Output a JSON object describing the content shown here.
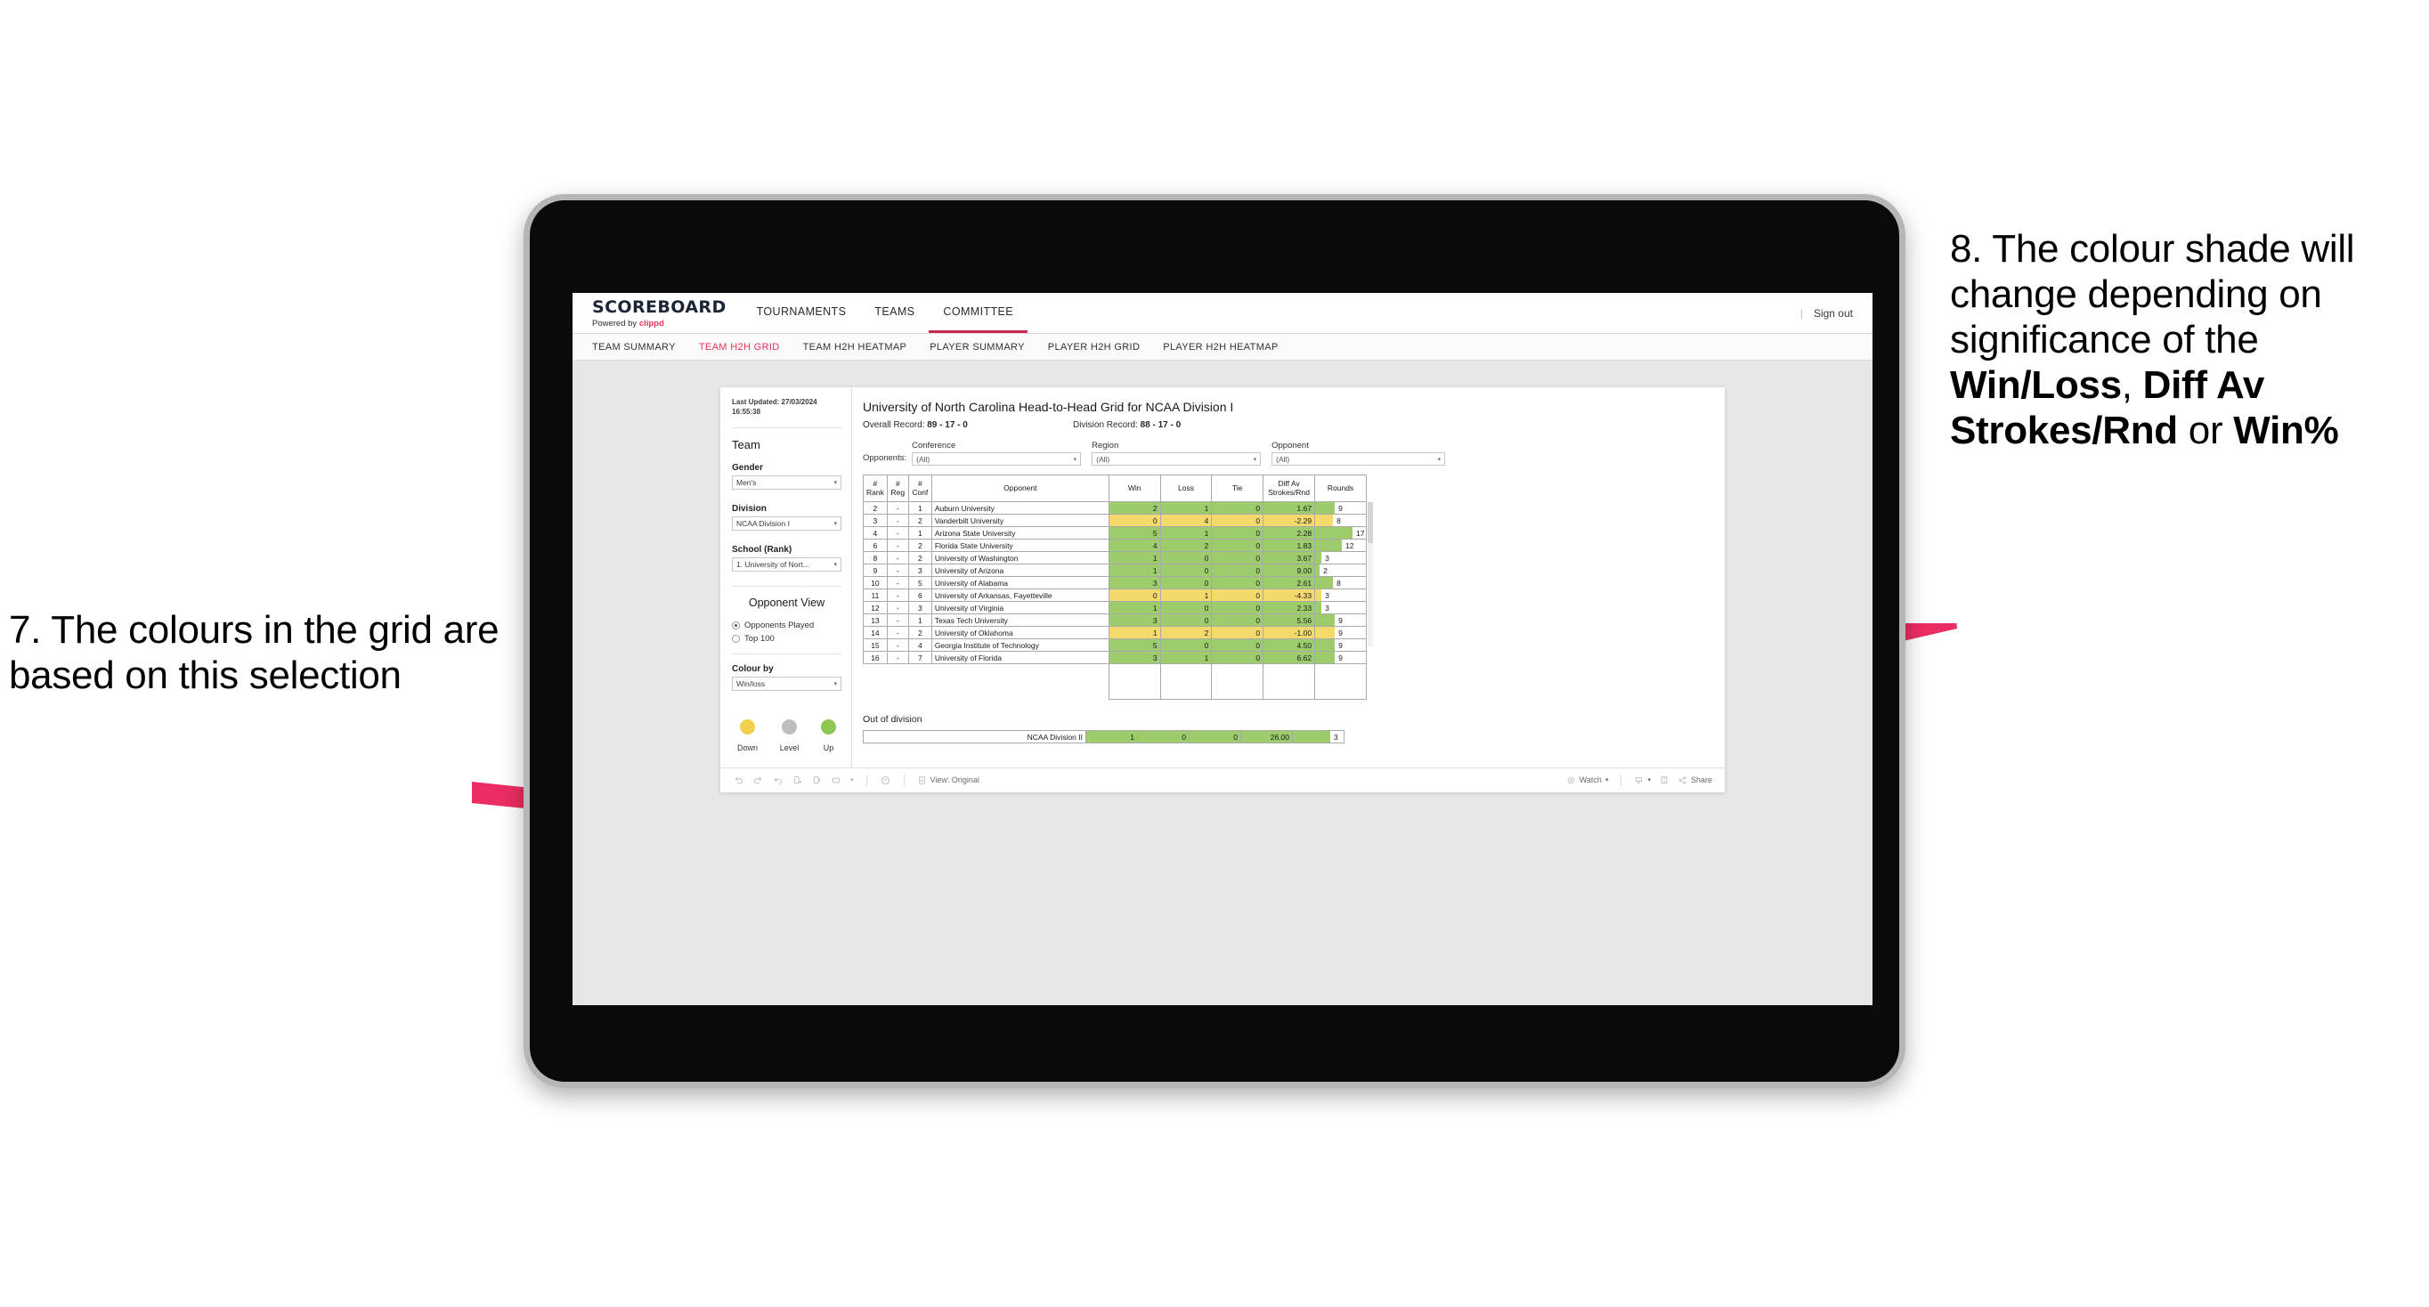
{
  "annotations": {
    "left": {
      "num": "7.",
      "text": "The colours in the grid are based on this selection"
    },
    "right": {
      "num": "8.",
      "lead": "The colour shade will change depending on significance of the ",
      "b1": "Win/Loss",
      "mid1": ", ",
      "b2": "Diff Av Strokes/Rnd",
      "mid2": " or ",
      "b3": "Win%"
    },
    "arrow_color": "#ec2d62"
  },
  "header": {
    "brand_name": "SCOREBOARD",
    "brand_sub_prefix": "Powered by ",
    "brand_sub_accent": "clippd",
    "nav": [
      {
        "label": "TOURNAMENTS",
        "active": false
      },
      {
        "label": "TEAMS",
        "active": false
      },
      {
        "label": "COMMITTEE",
        "active": true
      }
    ],
    "separator": "|",
    "sign_out": "Sign out",
    "accent_color": "#c8294c"
  },
  "subnav": [
    {
      "label": "TEAM SUMMARY",
      "active": false
    },
    {
      "label": "TEAM H2H GRID",
      "active": true
    },
    {
      "label": "TEAM H2H HEATMAP",
      "active": false
    },
    {
      "label": "PLAYER SUMMARY",
      "active": false
    },
    {
      "label": "PLAYER H2H GRID",
      "active": false
    },
    {
      "label": "PLAYER H2H HEATMAP",
      "active": false
    }
  ],
  "panel": {
    "last_updated": "Last Updated: 27/03/2024 16:55:38",
    "team_heading": "Team",
    "gender": {
      "label": "Gender",
      "value": "Men's"
    },
    "division": {
      "label": "Division",
      "value": "NCAA Division I"
    },
    "school": {
      "label": "School (Rank)",
      "value": "1. University of Nort..."
    },
    "opponent_view": {
      "heading": "Opponent View",
      "options": [
        {
          "label": "Opponents Played",
          "selected": true
        },
        {
          "label": "Top 100",
          "selected": false
        }
      ]
    },
    "colour_by": {
      "label": "Colour by",
      "value": "Win/loss"
    },
    "legend": [
      {
        "label": "Down",
        "color": "#f2d14e"
      },
      {
        "label": "Level",
        "color": "#bdbdbd"
      },
      {
        "label": "Up",
        "color": "#8dc653"
      }
    ]
  },
  "view": {
    "title": "University of North Carolina Head-to-Head Grid for NCAA Division I",
    "overall_record_label": "Overall Record: ",
    "overall_record": "89 - 17 - 0",
    "division_record_label": "Division Record: ",
    "division_record": "88 - 17 - 0",
    "opponents_label": "Opponents:",
    "filters": [
      {
        "caption": "Conference",
        "value": "(All)"
      },
      {
        "caption": "Region",
        "value": "(All)"
      },
      {
        "caption": "Opponent",
        "value": "(All)"
      }
    ],
    "columns": [
      "# Rank",
      "# Reg",
      "# Conf",
      "Opponent",
      "Win",
      "Loss",
      "Tie",
      "Diff Av Strokes/Rnd",
      "Rounds"
    ],
    "column_lines": {
      "rank": [
        "#",
        "Rank"
      ],
      "reg": [
        "#",
        "Reg"
      ],
      "conf": [
        "#",
        "Conf"
      ],
      "opp": [
        "Opponent"
      ],
      "win": [
        "Win"
      ],
      "loss": [
        "Loss"
      ],
      "tie": [
        "Tie"
      ],
      "diff": [
        "Diff Av",
        "Strokes/Rnd"
      ],
      "rounds": [
        "Rounds"
      ]
    },
    "rows": [
      {
        "rank": "2",
        "reg": "-",
        "conf": "1",
        "opponent": "Auburn University",
        "win": "2",
        "loss": "1",
        "tie": "0",
        "diff": "1.67",
        "rounds": "9",
        "shade": "g"
      },
      {
        "rank": "3",
        "reg": "-",
        "conf": "2",
        "opponent": "Vanderbilt University",
        "win": "0",
        "loss": "4",
        "tie": "0",
        "diff": "-2.29",
        "rounds": "8",
        "shade": "y"
      },
      {
        "rank": "4",
        "reg": "-",
        "conf": "1",
        "opponent": "Arizona State University",
        "win": "5",
        "loss": "1",
        "tie": "0",
        "diff": "2.28",
        "rounds": "17",
        "shade": "g"
      },
      {
        "rank": "6",
        "reg": "-",
        "conf": "2",
        "opponent": "Florida State University",
        "win": "4",
        "loss": "2",
        "tie": "0",
        "diff": "1.83",
        "rounds": "12",
        "shade": "g"
      },
      {
        "rank": "8",
        "reg": "-",
        "conf": "2",
        "opponent": "University of Washington",
        "win": "1",
        "loss": "0",
        "tie": "0",
        "diff": "3.67",
        "rounds": "3",
        "shade": "g"
      },
      {
        "rank": "9",
        "reg": "-",
        "conf": "3",
        "opponent": "University of Arizona",
        "win": "1",
        "loss": "0",
        "tie": "0",
        "diff": "9.00",
        "rounds": "2",
        "shade": "g"
      },
      {
        "rank": "10",
        "reg": "-",
        "conf": "5",
        "opponent": "University of Alabama",
        "win": "3",
        "loss": "0",
        "tie": "0",
        "diff": "2.61",
        "rounds": "8",
        "shade": "g"
      },
      {
        "rank": "11",
        "reg": "-",
        "conf": "6",
        "opponent": "University of Arkansas, Fayetteville",
        "win": "0",
        "loss": "1",
        "tie": "0",
        "diff": "-4.33",
        "rounds": "3",
        "shade": "y"
      },
      {
        "rank": "12",
        "reg": "-",
        "conf": "3",
        "opponent": "University of Virginia",
        "win": "1",
        "loss": "0",
        "tie": "0",
        "diff": "2.33",
        "rounds": "3",
        "shade": "g"
      },
      {
        "rank": "13",
        "reg": "-",
        "conf": "1",
        "opponent": "Texas Tech University",
        "win": "3",
        "loss": "0",
        "tie": "0",
        "diff": "5.56",
        "rounds": "9",
        "shade": "g"
      },
      {
        "rank": "14",
        "reg": "-",
        "conf": "2",
        "opponent": "University of Oklahoma",
        "win": "1",
        "loss": "2",
        "tie": "0",
        "diff": "-1.00",
        "rounds": "9",
        "shade": "y"
      },
      {
        "rank": "15",
        "reg": "-",
        "conf": "4",
        "opponent": "Georgia Institute of Technology",
        "win": "5",
        "loss": "0",
        "tie": "0",
        "diff": "4.50",
        "rounds": "9",
        "shade": "g"
      },
      {
        "rank": "16",
        "reg": "-",
        "conf": "7",
        "opponent": "University of Florida",
        "win": "3",
        "loss": "1",
        "tie": "0",
        "diff": "6.62",
        "rounds": "9",
        "shade": "g"
      }
    ],
    "out_of_division": {
      "title": "Out of division",
      "row": {
        "label": "NCAA Division II",
        "win": "1",
        "loss": "0",
        "tie": "0",
        "diff": "26.00",
        "rounds": "3",
        "shade": "g"
      }
    },
    "colors": {
      "green": "#9ccc6b",
      "yellow": "#f4da6c"
    }
  },
  "toolbar": {
    "view_label": "View: Original",
    "watch_label": "Watch",
    "share_label": "Share",
    "icons": [
      "undo-icon",
      "redo-icon",
      "revert-icon",
      "refresh-icon",
      "pause-icon",
      "rectangle-select-icon",
      "caret-down-icon",
      "help-icon",
      "view-icon",
      "watch-icon",
      "device-layout-icon",
      "fullscreen-icon",
      "share-icon"
    ]
  },
  "chart_data": {
    "type": "table",
    "title": "University of North Carolina Head-to-Head Grid for NCAA Division I",
    "columns": [
      "# Rank",
      "# Reg",
      "# Conf",
      "Opponent",
      "Win",
      "Loss",
      "Tie",
      "Diff Av Strokes/Rnd",
      "Rounds"
    ],
    "rows": [
      [
        "2",
        "-",
        "1",
        "Auburn University",
        2,
        1,
        0,
        1.67,
        9
      ],
      [
        "3",
        "-",
        "2",
        "Vanderbilt University",
        0,
        4,
        0,
        -2.29,
        8
      ],
      [
        "4",
        "-",
        "1",
        "Arizona State University",
        5,
        1,
        0,
        2.28,
        17
      ],
      [
        "6",
        "-",
        "2",
        "Florida State University",
        4,
        2,
        0,
        1.83,
        12
      ],
      [
        "8",
        "-",
        "2",
        "University of Washington",
        1,
        0,
        0,
        3.67,
        3
      ],
      [
        "9",
        "-",
        "3",
        "University of Arizona",
        1,
        0,
        0,
        9.0,
        2
      ],
      [
        "10",
        "-",
        "5",
        "University of Alabama",
        3,
        0,
        0,
        2.61,
        8
      ],
      [
        "11",
        "-",
        "6",
        "University of Arkansas, Fayetteville",
        0,
        1,
        0,
        -4.33,
        3
      ],
      [
        "12",
        "-",
        "3",
        "University of Virginia",
        1,
        0,
        0,
        2.33,
        3
      ],
      [
        "13",
        "-",
        "1",
        "Texas Tech University",
        3,
        0,
        0,
        5.56,
        9
      ],
      [
        "14",
        "-",
        "2",
        "University of Oklahoma",
        1,
        2,
        0,
        -1.0,
        9
      ],
      [
        "15",
        "-",
        "4",
        "Georgia Institute of Technology",
        5,
        0,
        0,
        4.5,
        9
      ],
      [
        "16",
        "-",
        "7",
        "University of Florida",
        3,
        1,
        0,
        6.62,
        9
      ]
    ],
    "out_of_division_rows": [
      [
        "NCAA Division II",
        1,
        0,
        0,
        26.0,
        3
      ]
    ],
    "colour_by": "Win/loss",
    "legend": [
      "Down",
      "Level",
      "Up"
    ],
    "rounds_max": 17
  }
}
